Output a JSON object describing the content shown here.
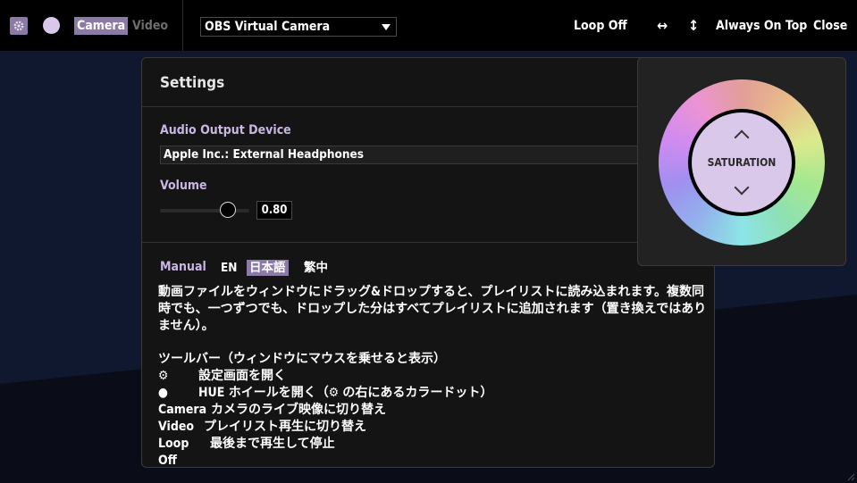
{
  "toolbar": {
    "camera_label": "Camera",
    "video_label": "Video",
    "source_select": "OBS Virtual Camera",
    "loop_label": "Loop Off",
    "horizontal_icon": "↔",
    "vertical_icon": "↕",
    "always_on_top_label": "Always On Top",
    "close_label": "Close"
  },
  "settings": {
    "title": "Settings",
    "audio_label": "Audio Output Device",
    "audio_value": "Apple Inc.: External Headphones",
    "volume_label": "Volume",
    "volume_value": "0.80",
    "volume_level": 0.8
  },
  "manual": {
    "label": "Manual",
    "languages": [
      "EN",
      "日本語",
      "繁中"
    ],
    "selected_language": "日本語",
    "paragraph1": "動画ファイルをウィンドウにドラッグ&ドロップすると、プレイリストに読み込まれます。複数同時でも、一つずつでも、ドロップした分はすべてプレイリストに追加されます（置き換えではありません）。",
    "toolbar_heading": "ツールバー（ウィンドウにマウスを乗せると表示）",
    "items": [
      {
        "key": "⚙",
        "value": "設定画面を開く"
      },
      {
        "key": "●",
        "value": "HUE ホイールを開く（⚙ の右にあるカラードット）"
      },
      {
        "key": "Camera",
        "value": "カメラのライブ映像に切り替え"
      },
      {
        "key": "Video",
        "value": "プレイリスト再生に切り替え"
      },
      {
        "key": "Loop Off",
        "value": "最後まで再生して停止"
      }
    ]
  },
  "hue_wheel": {
    "saturation_label": "SATURATION"
  },
  "colors": {
    "accent": "#8c7aa6",
    "label": "#c9b6e2",
    "dot": "#d9c8ea"
  }
}
